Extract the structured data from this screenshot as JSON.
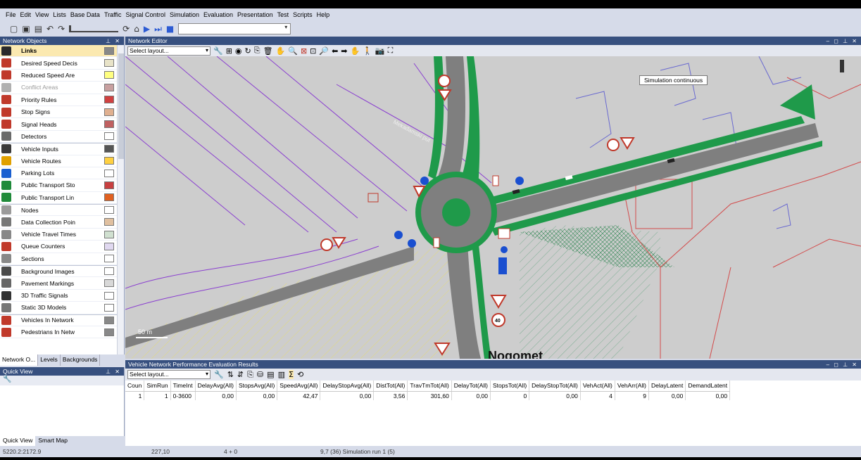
{
  "menu": [
    "File",
    "Edit",
    "View",
    "Lists",
    "Base Data",
    "Traffic",
    "Signal Control",
    "Simulation",
    "Evaluation",
    "Presentation",
    "Test",
    "Scripts",
    "Help"
  ],
  "toolbar": {
    "icons": [
      "new-icon",
      "open-icon",
      "save-icon",
      "undo-icon",
      "redo-icon",
      "speed-slider",
      "step-icon",
      "play-icon",
      "step-forward-icon",
      "stop-icon"
    ]
  },
  "left_panel": {
    "title": "Network Objects",
    "items": [
      {
        "label": "Links",
        "icon": "links-icon",
        "color": "#2a2a2a",
        "swatch": "#888888",
        "selected": true
      },
      {
        "label": "Desired Speed Decis",
        "icon": "speed-sign-icon",
        "color": "#c0392b",
        "swatch": "#e8e3c8"
      },
      {
        "label": "Reduced Speed Are",
        "icon": "warning-icon",
        "color": "#c0392b",
        "swatch": "#ffff80"
      },
      {
        "label": "Conflict Areas",
        "icon": "conflict-icon",
        "color": "#b0b0b0",
        "swatch": "#c8a0a0",
        "disabled": true
      },
      {
        "label": "Priority Rules",
        "icon": "yield-icon",
        "color": "#c0392b",
        "swatch": "#d04040"
      },
      {
        "label": "Stop Signs",
        "icon": "stop-icon",
        "color": "#c0392b",
        "swatch": "#e0b090"
      },
      {
        "label": "Signal Heads",
        "icon": "signal-icon",
        "color": "#c0392b",
        "swatch": "#c06060"
      },
      {
        "label": "Detectors",
        "icon": "detector-icon",
        "color": "#6a6a6a",
        "swatch": "#ffffff"
      },
      {
        "label": "Vehicle Inputs",
        "icon": "vehicle-input-icon",
        "color": "#3a3a3a",
        "swatch": "#555555",
        "sep": true
      },
      {
        "label": "Vehicle Routes",
        "icon": "route-icon",
        "color": "#e0a000",
        "swatch": "#ffd040"
      },
      {
        "label": "Parking Lots",
        "icon": "parking-icon",
        "color": "#1a5fd0",
        "swatch": "#ffffff"
      },
      {
        "label": "Public Transport Sto",
        "icon": "pt-stop-icon",
        "color": "#1f8a3a",
        "swatch": "#c84040"
      },
      {
        "label": "Public Transport Lin",
        "icon": "pt-line-icon",
        "color": "#1f8a3a",
        "swatch": "#e06020"
      },
      {
        "label": "Nodes",
        "icon": "nodes-icon",
        "color": "#9a9a9a",
        "swatch": "#ffffff",
        "sep": true
      },
      {
        "label": "Data Collection Poin",
        "icon": "data-point-icon",
        "color": "#777777",
        "swatch": "#e0c0a0"
      },
      {
        "label": "Vehicle Travel Times",
        "icon": "travel-time-icon",
        "color": "#888888",
        "swatch": "#d0e0d0"
      },
      {
        "label": "Queue Counters",
        "icon": "queue-icon",
        "color": "#c0392b",
        "swatch": "#e0d8f0"
      },
      {
        "label": "Sections",
        "icon": "sections-icon",
        "color": "#888888",
        "swatch": "#ffffff"
      },
      {
        "label": "Background Images",
        "icon": "image-icon",
        "color": "#4a4a4a",
        "swatch": "#ffffff",
        "sep": true
      },
      {
        "label": "Pavement Markings",
        "icon": "marking-icon",
        "color": "#666666",
        "swatch": "#d8d8d8"
      },
      {
        "label": "3D Traffic Signals",
        "icon": "3d-signal-icon",
        "color": "#333333",
        "swatch": "#ffffff"
      },
      {
        "label": "Static 3D Models",
        "icon": "model-icon",
        "color": "#777777",
        "swatch": "#ffffff"
      },
      {
        "label": "Vehicles In Network",
        "icon": "vehicle-icon",
        "color": "#c0392b",
        "swatch": "#888888",
        "sep": true
      },
      {
        "label": "Pedestrians In Netw",
        "icon": "pedestrian-icon",
        "color": "#c0392b",
        "swatch": "#888888"
      }
    ],
    "tabs": [
      "Network O...",
      "Levels",
      "Backgrounds"
    ]
  },
  "quick_view": {
    "title": "Quick View",
    "tabs": [
      "Quick View",
      "Smart Map"
    ]
  },
  "editor": {
    "title": "Network Editor",
    "layout_placeholder": "Select layout...",
    "tooltip": "Simulation continuous",
    "scale_label": "50 m",
    "street_label_1": "Mekađamski put",
    "street_label_2": "Nogomet",
    "sign_40": "40"
  },
  "results": {
    "title": "Vehicle Network Performance Evaluation Results",
    "layout_placeholder": "Select layout...",
    "columns": [
      "Coun",
      "SimRun",
      "TimeInt",
      "DelayAvg(All)",
      "StopsAvg(All)",
      "SpeedAvg(All)",
      "DelayStopAvg(All)",
      "DistTot(All)",
      "TravTmTot(All)",
      "DelayTot(All)",
      "StopsTot(All)",
      "DelayStopTot(All)",
      "VehAct(All)",
      "VehArr(All)",
      "DelayLatent",
      "DemandLatent"
    ],
    "rows": [
      [
        "1",
        "1",
        "0-3600",
        "0,00",
        "0,00",
        "42,47",
        "0,00",
        "3,56",
        "301,60",
        "0,00",
        "0",
        "0,00",
        "4",
        "9",
        "0,00",
        "0,00"
      ]
    ]
  },
  "status": {
    "coords": "5220.2:2172.9",
    "value": "227,10",
    "counter": "4 + 0",
    "sim": "9,7 (36) Simulation run 1 (5)"
  },
  "colors": {
    "title_bar": "#37507f",
    "road": "#7f7f7f",
    "grass": "#1f9a4a",
    "hatch_yellow": "#e3da7a",
    "hatch_purple": "#8a3fd0",
    "hatch_red": "#d34a4a",
    "background": "#cdcdcd"
  }
}
